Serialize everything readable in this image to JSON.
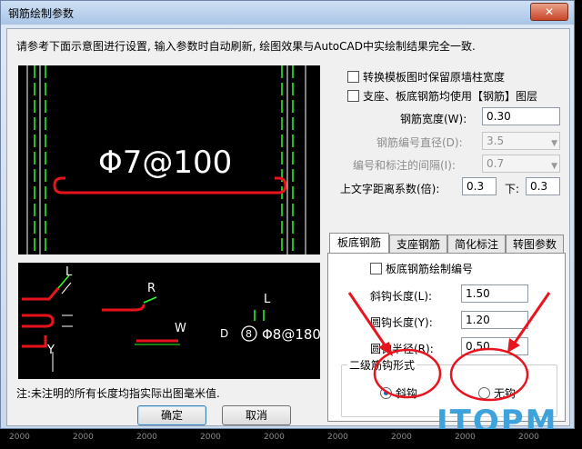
{
  "window": {
    "title": "钢筋绘制参数",
    "close_glyph": "✕"
  },
  "intro_text": "请参考下面示意图进行设置, 输入参数时自动刷新, 绘图效果与AutoCAD中实绘制结果完全一致.",
  "preview_top": {
    "label": "Φ7@100"
  },
  "preview_bottom": {
    "label_L": "L",
    "label_R": "R",
    "label_W": "W",
    "label_L2": "L",
    "label_D": "D",
    "label_Y": "Y",
    "circle_num": "8",
    "bar_label": "Φ8@180"
  },
  "options": {
    "keep_wall_width": {
      "label": "转换模板图时保留原墙柱宽度",
      "checked": false
    },
    "use_rebar_layer": {
      "label": "支座、板底钢筋均使用【钢筋】图层",
      "checked": false
    }
  },
  "params": {
    "rebar_width": {
      "label": "钢筋宽度(W):",
      "value": "0.30"
    },
    "rebar_num_diameter": {
      "label": "钢筋编号直径(D):",
      "value": "3.5"
    },
    "num_label_gap": {
      "label": "编号和标注的间隔(I):",
      "value": "0.7"
    },
    "text_distance": {
      "label": "上文字距离系数(倍):",
      "value": "0.3",
      "down_label": "下:",
      "down_value": "0.3"
    }
  },
  "tabs": [
    "板底钢筋",
    "支座钢筋",
    "简化标注",
    "转图参数"
  ],
  "tab_panel": {
    "draw_number": {
      "label": "板底钢筋绘制编号",
      "checked": false
    },
    "hook_length": {
      "label": "斜钩长度(L):",
      "value": "1.50"
    },
    "round_hook_length": {
      "label": "圆钩长度(Y):",
      "value": "1.20"
    },
    "hook_radius": {
      "label": "圆钩半径(R):",
      "value": "0.50"
    },
    "hook_group": {
      "title": "二级筋钩形式",
      "option_slant": "斜钩",
      "option_none": "无钩",
      "selected": "斜钩"
    }
  },
  "note": "注:未注明的所有长度均指实际出图毫米值.",
  "buttons": {
    "ok": "确定",
    "cancel": "取消"
  },
  "watermark": "ITOPM",
  "ruler_ticks": [
    "2000",
    "2000",
    "2000",
    "2000",
    "2000",
    "2000",
    "2000",
    "2000",
    "2000"
  ],
  "colors": {
    "accent_red": "#e8141d",
    "cad_green": "#28ff28",
    "cad_white": "#ffffff"
  }
}
